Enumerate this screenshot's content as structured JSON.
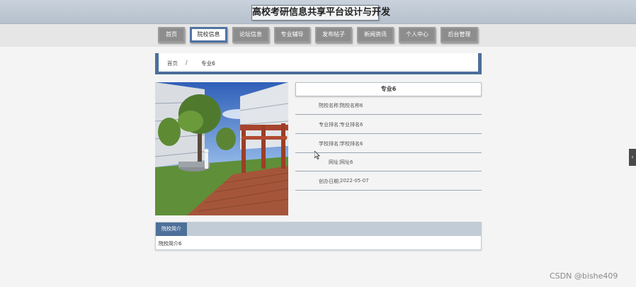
{
  "header": {
    "title": "高校考研信息共享平台设计与开发"
  },
  "nav": {
    "items": [
      {
        "label": "首页",
        "active": false
      },
      {
        "label": "院校信息",
        "active": true
      },
      {
        "label": "论坛信息",
        "active": false
      },
      {
        "label": "专业辅导",
        "active": false
      },
      {
        "label": "发布帖子",
        "active": false
      },
      {
        "label": "新闻资讯",
        "active": false
      },
      {
        "label": "个人中心",
        "active": false
      },
      {
        "label": "后台管理",
        "active": false
      }
    ]
  },
  "breadcrumb": {
    "home": "首页",
    "separator": "/",
    "current": "专业6"
  },
  "detail": {
    "title": "专业6",
    "fields": [
      {
        "label": "院校名称：",
        "value": "院校名称6"
      },
      {
        "label": "专业排名：",
        "value": "专业排名6"
      },
      {
        "label": "学校排名：",
        "value": "学校排名6"
      },
      {
        "label": "网址：",
        "value": "网址6"
      },
      {
        "label": "创办日期：",
        "value": "2022-05-07"
      }
    ]
  },
  "intro": {
    "tab_label": "院校简介",
    "content": "院校简介6"
  },
  "side_toggle": {
    "glyph": "‹"
  },
  "watermark": "CSDN @bishe409",
  "colors": {
    "accent": "#4c6f9a",
    "nav_button": "#8d8d8d",
    "header_bg": "#c0cad5"
  }
}
